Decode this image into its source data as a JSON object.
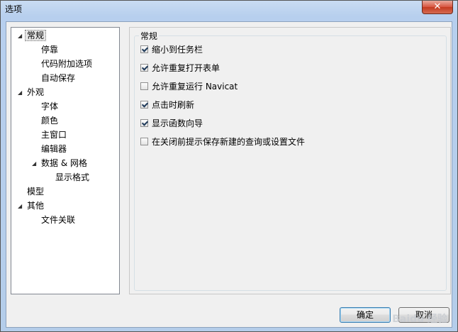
{
  "window": {
    "title": "选项",
    "close_glyph": "✕"
  },
  "tree": {
    "items": [
      {
        "label": "常规",
        "expanded": true,
        "selected": true
      },
      {
        "label": "停靠"
      },
      {
        "label": "代码附加选项"
      },
      {
        "label": "自动保存"
      },
      {
        "label": "外观",
        "expanded": true
      },
      {
        "label": "字体"
      },
      {
        "label": "颜色"
      },
      {
        "label": "主窗口"
      },
      {
        "label": "编辑器"
      },
      {
        "label": "数据 & 网格",
        "expanded": true
      },
      {
        "label": "显示格式"
      },
      {
        "label": "模型"
      },
      {
        "label": "其他",
        "expanded": true
      },
      {
        "label": "文件关联"
      }
    ]
  },
  "group": {
    "title": "常规",
    "options": [
      {
        "label": "缩小到任务栏",
        "checked": true
      },
      {
        "label": "允许重复打开表单",
        "checked": true
      },
      {
        "label": "允许重复运行 Navicat",
        "checked": false
      },
      {
        "label": "点击时刷新",
        "checked": true
      },
      {
        "label": "显示函数向导",
        "checked": true
      },
      {
        "label": "在关闭前提示保存新建的查询或设置文件",
        "checked": false
      }
    ]
  },
  "buttons": {
    "ok": "确定",
    "cancel": "取消"
  },
  "watermark": "Baidu 经验"
}
